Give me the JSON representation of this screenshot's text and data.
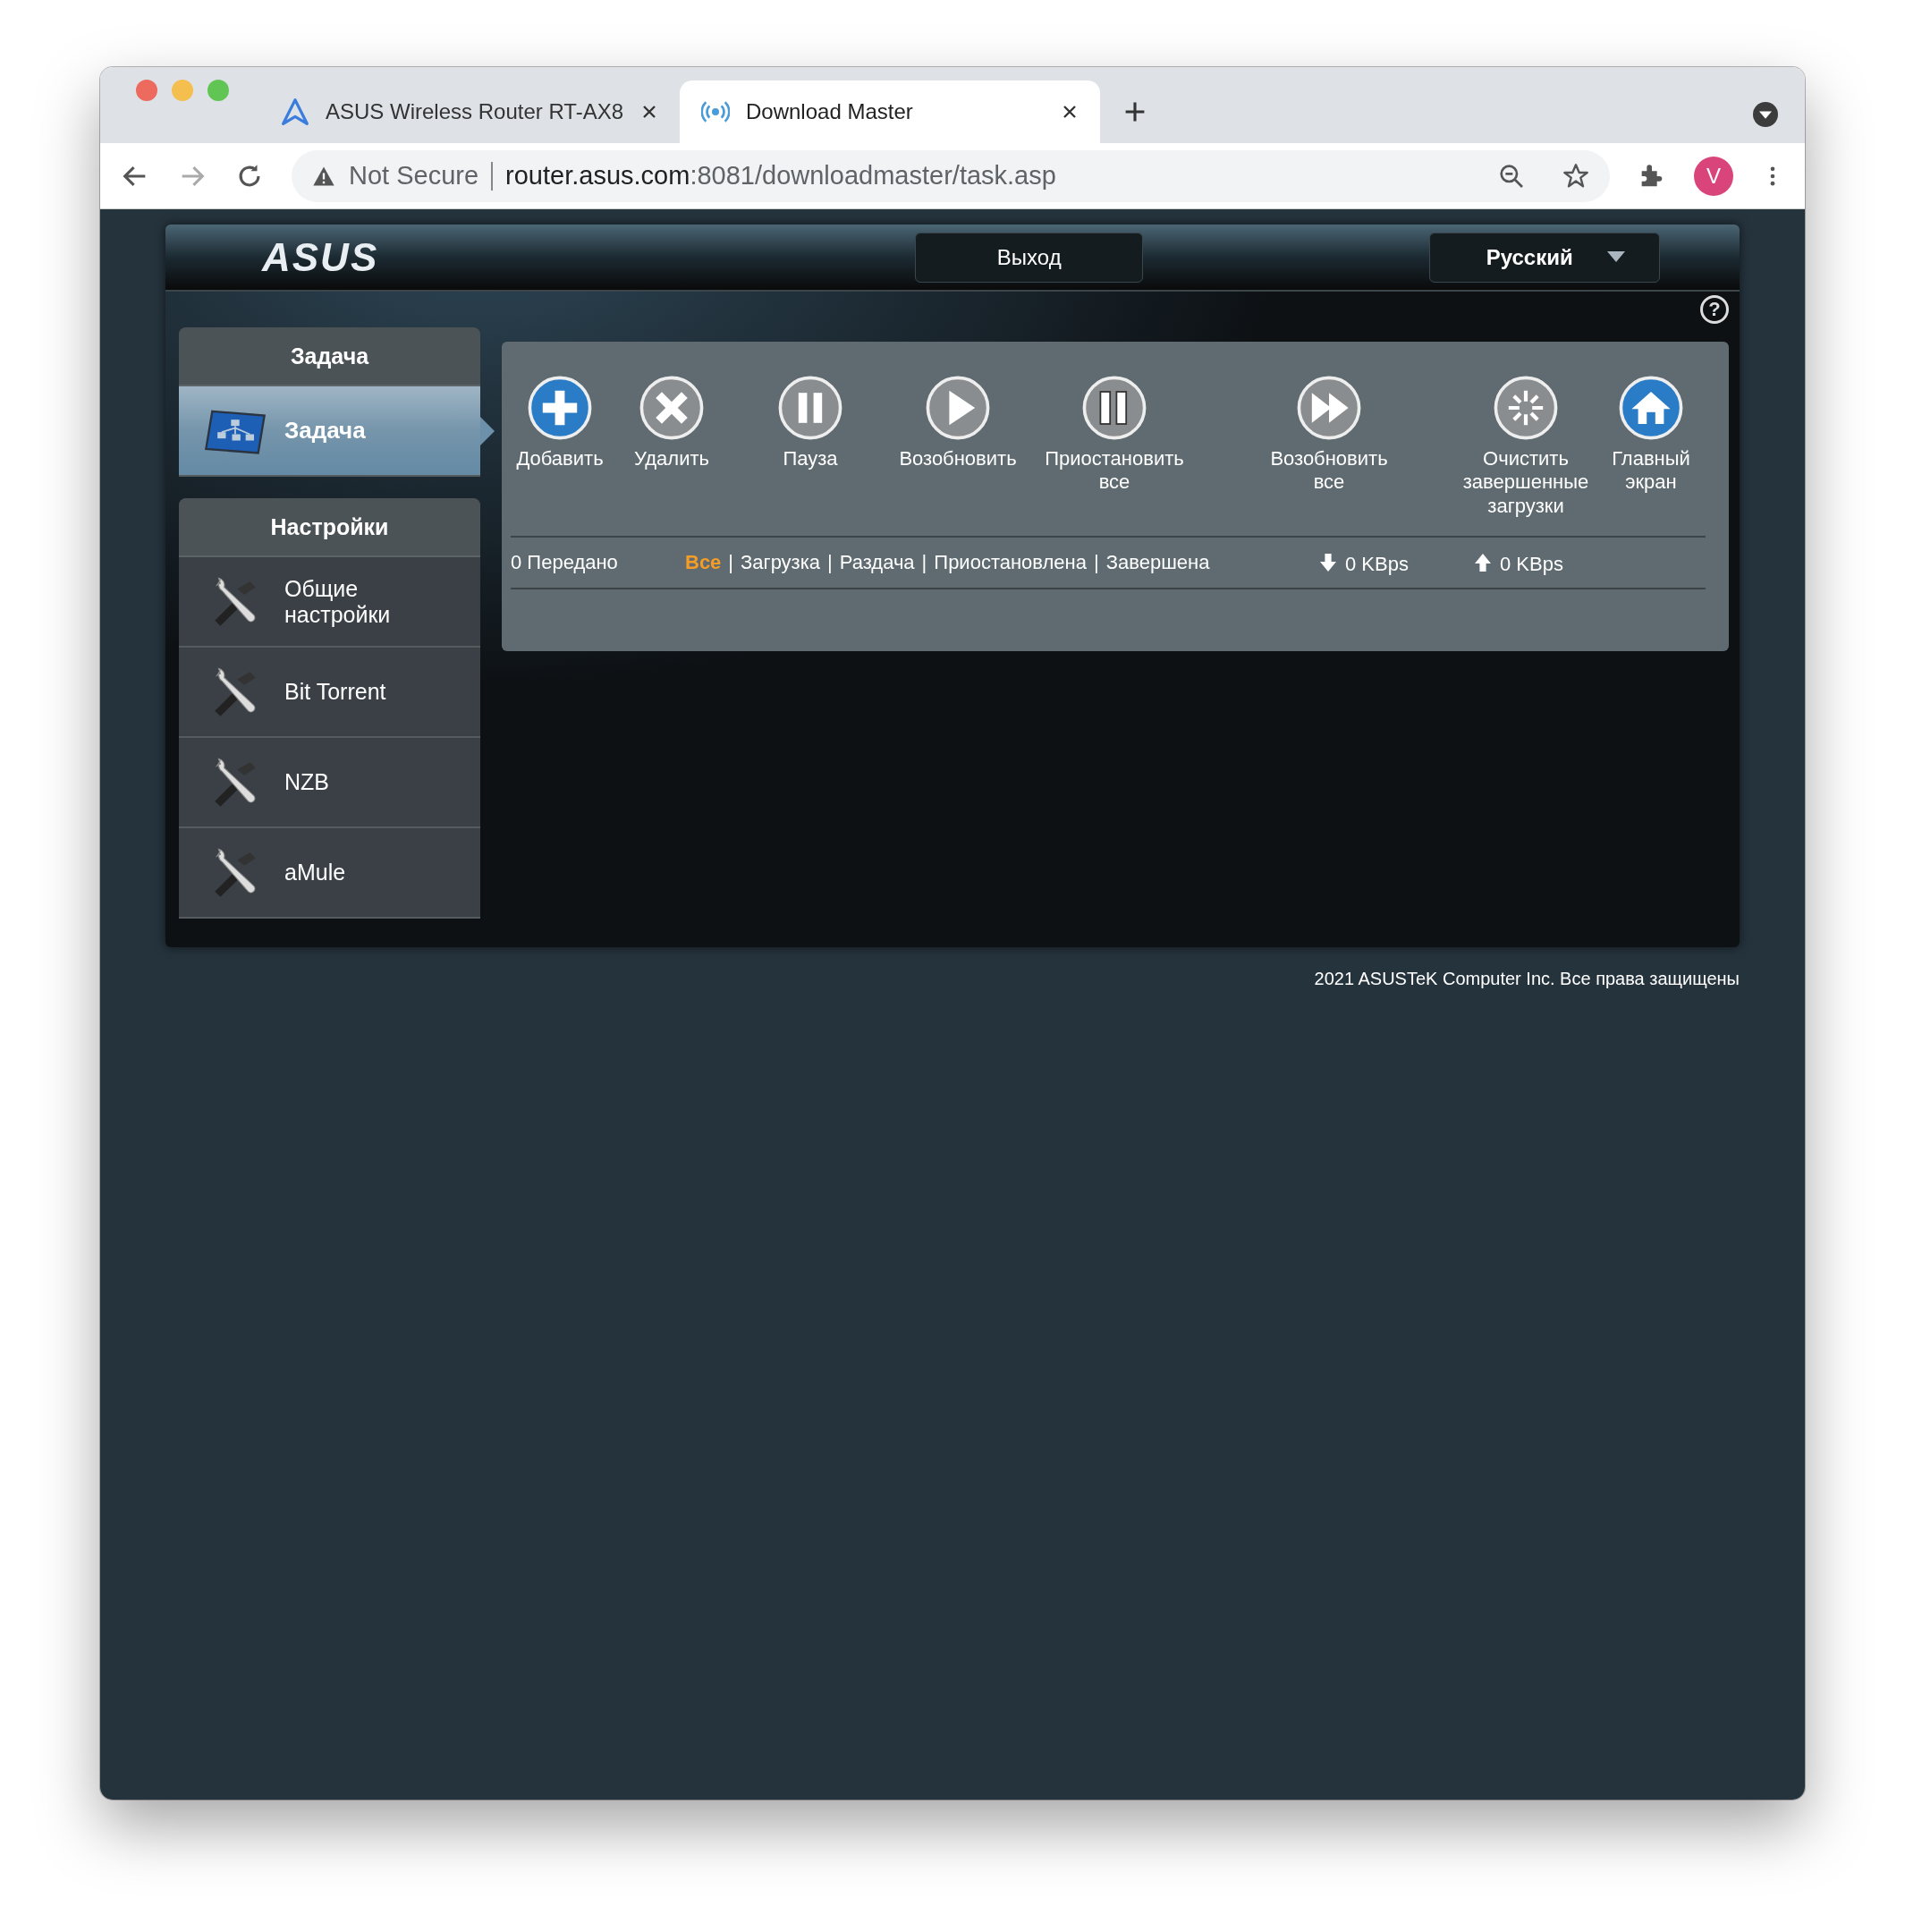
{
  "browser": {
    "tabs": [
      {
        "title": "ASUS Wireless Router RT-AX8",
        "selected": false,
        "kind": "router"
      },
      {
        "title": "Download Master",
        "selected": true,
        "kind": "download"
      }
    ],
    "address": {
      "security": "Not Secure",
      "host": "router.asus.com",
      "path": ":8081/downloadmaster/task.asp"
    },
    "profile": "V"
  },
  "header": {
    "logo": "ASUS",
    "logout": "Выход",
    "language": "Русский",
    "help": "?"
  },
  "sidebar": [
    {
      "title": "Задача",
      "items": [
        {
          "label": "Задача",
          "kind": "task",
          "selected": true
        }
      ]
    },
    {
      "title": "Настройки",
      "items": [
        {
          "label": "Общие настройки",
          "kind": "settings",
          "selected": false
        },
        {
          "label": "Bit Torrent",
          "kind": "settings",
          "selected": false
        },
        {
          "label": "NZB",
          "kind": "settings",
          "selected": false
        },
        {
          "label": "aMule",
          "kind": "settings",
          "selected": false
        }
      ]
    }
  ],
  "toolbar": [
    {
      "label": "Добавить",
      "kind": "add"
    },
    {
      "label": "Удалить",
      "kind": "delete"
    },
    {
      "label": "Пауза",
      "kind": "pause"
    },
    {
      "label": "Возобновить",
      "kind": "resume"
    },
    {
      "label": "Приостановить все",
      "kind": "pause_all"
    },
    {
      "label": "Возобновить все",
      "kind": "resume_all"
    },
    {
      "label": "Очистить завершенные загрузки",
      "kind": "clear"
    },
    {
      "label": "Главный экран",
      "kind": "home"
    }
  ],
  "status": {
    "transferred": "0 Передано",
    "separator": "|",
    "filters": [
      {
        "label": "Все",
        "selected": true
      },
      {
        "label": "Загрузка",
        "selected": false
      },
      {
        "label": "Раздача",
        "selected": false
      },
      {
        "label": "Приостановлена",
        "selected": false
      },
      {
        "label": "Завершена",
        "selected": false
      }
    ],
    "download_speed": "0 KBps",
    "upload_speed": "0 KBps"
  },
  "footer": "2021 ASUSTeK Computer Inc. Все права защищены"
}
